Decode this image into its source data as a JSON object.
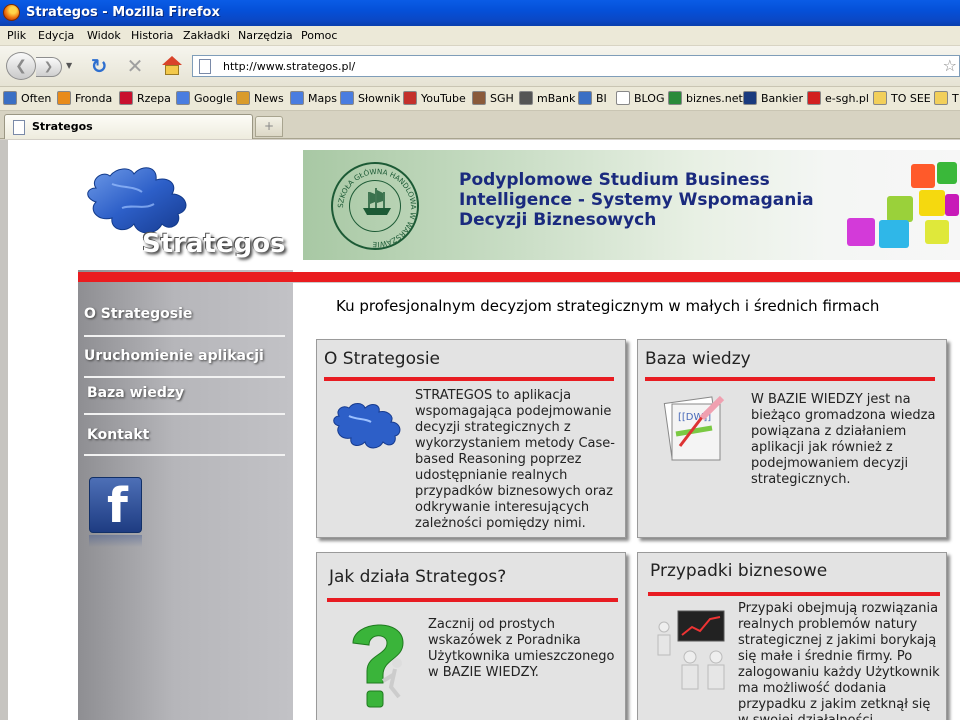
{
  "window": {
    "title": "Strategos - Mozilla Firefox"
  },
  "menu": [
    "Plik",
    "Edycja",
    "Widok",
    "Historia",
    "Zakładki",
    "Narzędzia",
    "Pomoc"
  ],
  "navigation": {
    "url": "http://www.strategos.pl/"
  },
  "bookmarks": [
    {
      "label": "Often",
      "icon": "search-bookmark-icon",
      "color": "#3a6fc4"
    },
    {
      "label": "Fronda",
      "icon": "fronda-icon",
      "color": "#e88b1a"
    },
    {
      "label": "Rzepa",
      "icon": "rzepa-icon",
      "color": "#c8102e"
    },
    {
      "label": "Google",
      "icon": "google-icon",
      "color": "#4a7de0"
    },
    {
      "label": "News",
      "icon": "news-icon",
      "color": "#d99b2b"
    },
    {
      "label": "Maps",
      "icon": "maps-icon",
      "color": "#4a7de0"
    },
    {
      "label": "Słownik",
      "icon": "slownik-icon",
      "color": "#4a7de0"
    },
    {
      "label": "YouTube",
      "icon": "youtube-icon",
      "color": "#c4302b"
    },
    {
      "label": "SGH",
      "icon": "sgh-icon",
      "color": "#8a5a3a"
    },
    {
      "label": "mBank",
      "icon": "mbank-icon",
      "color": "#555555"
    },
    {
      "label": "BI",
      "icon": "bi-icon",
      "color": "#3a6fc4"
    },
    {
      "label": "BLOG",
      "icon": "page-icon",
      "color": "#ffffff"
    },
    {
      "label": "biznes.net",
      "icon": "biznes-icon",
      "color": "#2a8a3a"
    },
    {
      "label": "Bankier",
      "icon": "bankier-icon",
      "color": "#1a3a7e"
    },
    {
      "label": "e-sgh.pl",
      "icon": "esgh-icon",
      "color": "#d21f1f"
    },
    {
      "label": "TO SEE",
      "icon": "folder-icon",
      "color": "#f2cf5a"
    },
    {
      "label": "T",
      "icon": "folder-icon",
      "color": "#f2cf5a"
    }
  ],
  "tabs": [
    {
      "label": "Strategos"
    }
  ],
  "site": {
    "logo_text": "Strategos",
    "banner": {
      "title": "Podyplomowe Studium Business Intelligence - Systemy Wspomagania Decyzji Biznesowych",
      "seal_text": "SZKOŁA GŁÓWNA HANDLOWA W WARSZAWIE"
    },
    "nav": [
      "O Strategosie",
      "Uruchomienie aplikacji",
      "Baza wiedzy",
      "Kontakt"
    ],
    "slogan": "Ku profesjonalnym decyzjom strategicznym w małych i średnich firmach",
    "cards": [
      {
        "title": "O Strategosie",
        "text": "STRATEGOS to aplikacja wspomagająca podejmowanie decyzji strategicznych z wykorzystaniem metody Case-based Reasoning poprzez udostępnianie realnych przypadków biznesowych oraz odkrywanie interesujących zależności pomiędzy nimi."
      },
      {
        "title": "Baza wiedzy",
        "text": "W BAZIE WIEDZY jest na bieżąco gromadzona wiedza powiązana z działaniem aplikacji jak również z podejmowaniem decyzji strategicznych."
      },
      {
        "title": "Jak działa Strategos?",
        "text": "Zacznij od prostych wskazówek z Poradnika Użytkownika umieszczonego w BAZIE WIEDZY."
      },
      {
        "title": "Przypadki biznesowe",
        "text": "Przypaki obejmują rozwiązania realnych problemów natury strategicznej z jakimi borykają się małe i średnie firmy. Po zalogowaniu każdy Użytkownik ma możliwość dodania przypadku z jakim zetknął się w swojej działalności."
      }
    ]
  },
  "colors": {
    "accent_red": "#ea1c1f",
    "banner_title": "#1a2a7e",
    "titlebar": "#0a5ce6"
  }
}
